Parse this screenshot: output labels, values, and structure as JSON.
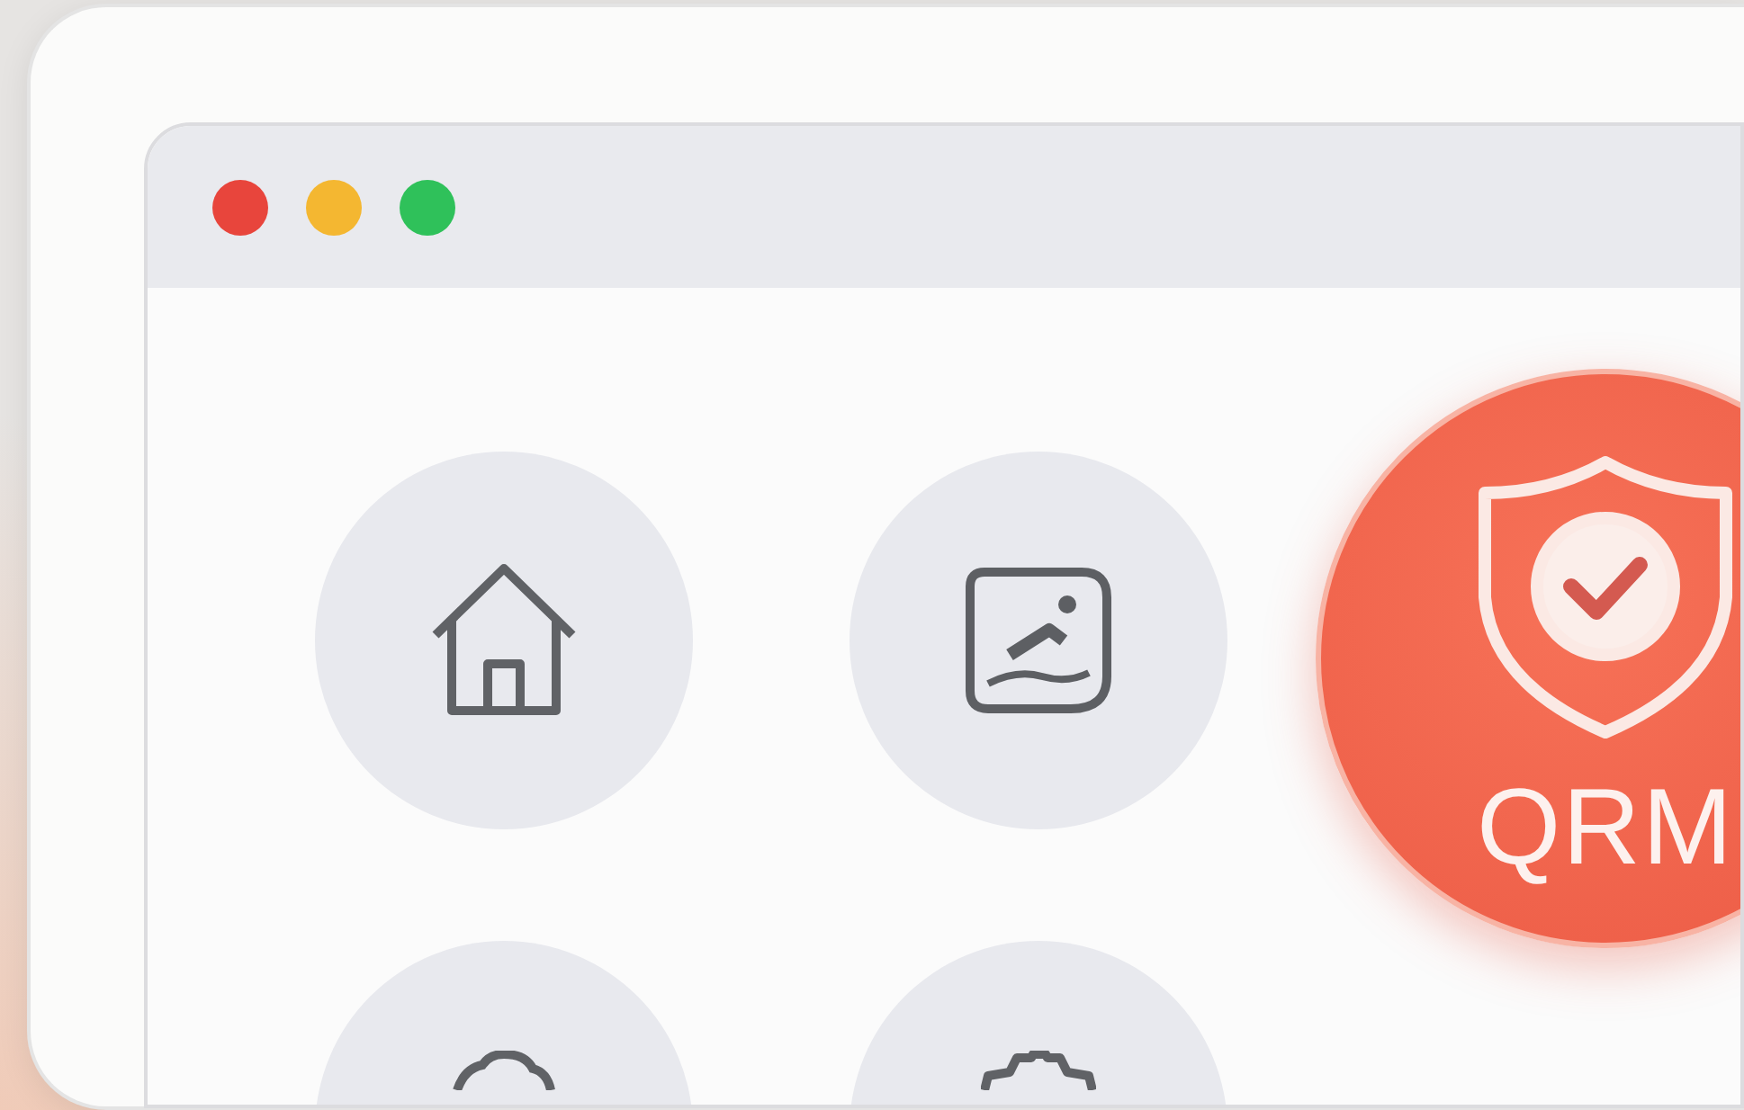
{
  "window": {
    "controls": [
      {
        "color": "#e8453c"
      },
      {
        "color": "#f4b731"
      },
      {
        "color": "#2fc15a"
      }
    ]
  },
  "tiles": [
    {
      "kind": "home",
      "selected": false
    },
    {
      "kind": "picture",
      "selected": false
    },
    {
      "kind": "shield",
      "label": "QRM",
      "selected": true
    },
    {
      "kind": "cloud",
      "selected": false
    },
    {
      "kind": "gear",
      "selected": false
    }
  ]
}
